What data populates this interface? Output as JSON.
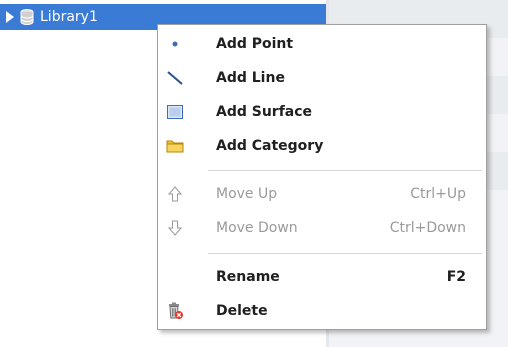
{
  "tree": {
    "selected_node_label": "Library1"
  },
  "context_menu": {
    "items": [
      {
        "label": "Add Point",
        "shortcut": "",
        "enabled": true
      },
      {
        "label": "Add Line",
        "shortcut": "",
        "enabled": true
      },
      {
        "label": "Add Surface",
        "shortcut": "",
        "enabled": true
      },
      {
        "label": "Add Category",
        "shortcut": "",
        "enabled": true
      },
      {
        "label": "Move Up",
        "shortcut": "Ctrl+Up",
        "enabled": false
      },
      {
        "label": "Move Down",
        "shortcut": "Ctrl+Down",
        "enabled": false
      },
      {
        "label": "Rename",
        "shortcut": "F2",
        "enabled": true
      },
      {
        "label": "Delete",
        "shortcut": "",
        "enabled": true
      }
    ]
  },
  "colors": {
    "selection": "#3a7bd5",
    "disabled_text": "#9a9a9a",
    "folder_yellow": "#f2c12e",
    "point_blue": "#3d6fb8"
  }
}
